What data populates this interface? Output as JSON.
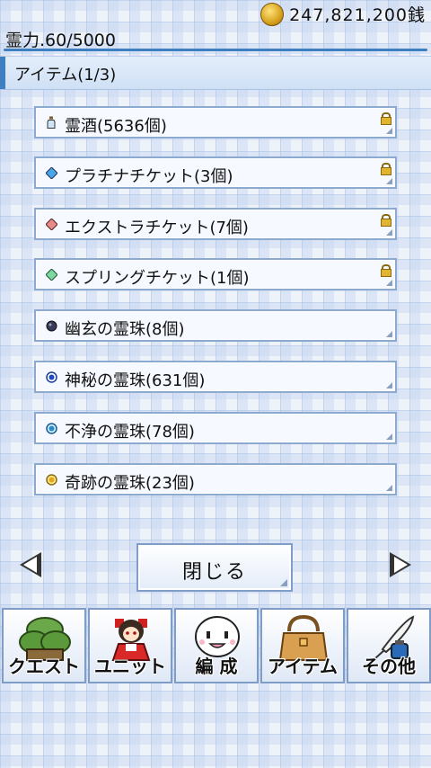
{
  "header": {
    "money": "247,821,200銭",
    "spirit": "霊力.60/5000"
  },
  "section": {
    "title": "アイテム(1/3)"
  },
  "items": [
    {
      "label": "霊酒(5636個)",
      "icon": "sake-bottle-icon",
      "locked": true
    },
    {
      "label": "プラチナチケット(3個)",
      "icon": "blue-ticket-icon",
      "locked": true
    },
    {
      "label": "エクストラチケット(7個)",
      "icon": "red-ticket-icon",
      "locked": true
    },
    {
      "label": "スプリングチケット(1個)",
      "icon": "green-ticket-icon",
      "locked": true
    },
    {
      "label": "幽玄の霊珠(8個)",
      "icon": "dark-orb-icon",
      "locked": false
    },
    {
      "label": "神秘の霊珠(631個)",
      "icon": "blue-orb-icon",
      "locked": false
    },
    {
      "label": "不浄の霊珠(78個)",
      "icon": "cyan-orb-icon",
      "locked": false
    },
    {
      "label": "奇跡の霊珠(23個)",
      "icon": "gold-orb-icon",
      "locked": false
    }
  ],
  "close_label": "閉じる",
  "tabs": [
    {
      "label": "クエスト",
      "icon": "forest-icon"
    },
    {
      "label": "ユニット",
      "icon": "shrine-maiden-icon"
    },
    {
      "label": "編 成",
      "icon": "spirit-face-icon"
    },
    {
      "label": "アイテム",
      "icon": "bag-icon"
    },
    {
      "label": "その他",
      "icon": "quill-ink-icon"
    }
  ],
  "colors": {
    "accent": "#3d7fc1",
    "border": "#8ca9cf"
  }
}
